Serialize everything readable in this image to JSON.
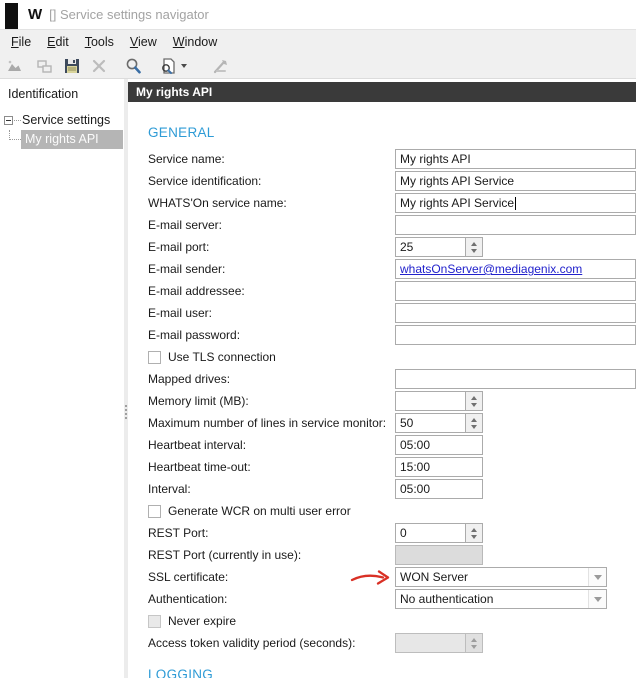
{
  "window": {
    "logo": "W",
    "title": "[] Service settings navigator"
  },
  "menu": {
    "items": [
      "File",
      "Edit",
      "Tools",
      "View",
      "Window"
    ]
  },
  "toolbar": {
    "icons": [
      "chart-icon",
      "cascade-windows-icon",
      "save-icon",
      "delete-icon",
      "search-icon",
      "search-document-icon",
      "tools-icon"
    ]
  },
  "sidebar": {
    "header": "Identification",
    "root_node": "Service settings",
    "selected_node": "My rights API"
  },
  "main": {
    "header_title": "My rights API",
    "section_general": "GENERAL",
    "section_logging": "LOGGING",
    "fields": [
      {
        "label": "Service name:",
        "value": "My rights API",
        "type": "text"
      },
      {
        "label": "Service identification:",
        "value": "My rights API Service",
        "type": "text"
      },
      {
        "label": "WHATS'On service name:",
        "value": "My rights API Service",
        "type": "text-caret"
      },
      {
        "label": "E-mail server:",
        "value": "",
        "type": "text"
      },
      {
        "label": "E-mail port:",
        "value": "25",
        "type": "spinner"
      },
      {
        "label": "E-mail sender:",
        "value": "whatsOnServer@mediagenix.com",
        "type": "link"
      },
      {
        "label": "E-mail addressee:",
        "value": "",
        "type": "text"
      },
      {
        "label": "E-mail user:",
        "value": "",
        "type": "text"
      },
      {
        "label": "E-mail password:",
        "value": "",
        "type": "text"
      },
      {
        "label": "Use TLS connection",
        "checked": false,
        "type": "checkbox"
      },
      {
        "label": "Mapped drives:",
        "value": "",
        "type": "text"
      },
      {
        "label": "Memory limit (MB):",
        "value": "",
        "type": "spinner"
      },
      {
        "label": "Maximum number of lines in service monitor:",
        "value": "50",
        "type": "spinner"
      },
      {
        "label": "Heartbeat interval:",
        "value": "05:00",
        "type": "time"
      },
      {
        "label": "Heartbeat time-out:",
        "value": "15:00",
        "type": "time"
      },
      {
        "label": "Interval:",
        "value": "05:00",
        "type": "time"
      },
      {
        "label": "Generate WCR on multi user error",
        "checked": false,
        "type": "checkbox"
      },
      {
        "label": "REST Port:",
        "value": "0",
        "type": "spinner"
      },
      {
        "label": "REST Port (currently in use):",
        "value": "",
        "type": "disabled-text"
      },
      {
        "label": "SSL certificate:",
        "value": "WON Server",
        "type": "dropdown",
        "annotation": "red-arrow"
      },
      {
        "label": "Authentication:",
        "value": "No authentication",
        "type": "dropdown"
      },
      {
        "label": "Never expire",
        "checked": false,
        "type": "checkbox-disabled"
      },
      {
        "label": "Access token validity period (seconds):",
        "value": "",
        "type": "disabled-spinner"
      }
    ]
  },
  "colors": {
    "accent_blue": "#2e9bd6",
    "header_bar": "#3a3a3a",
    "link_blue": "#2222cc",
    "annotation_red": "#d93025",
    "selected_tree_bg": "#b5b5b5"
  }
}
